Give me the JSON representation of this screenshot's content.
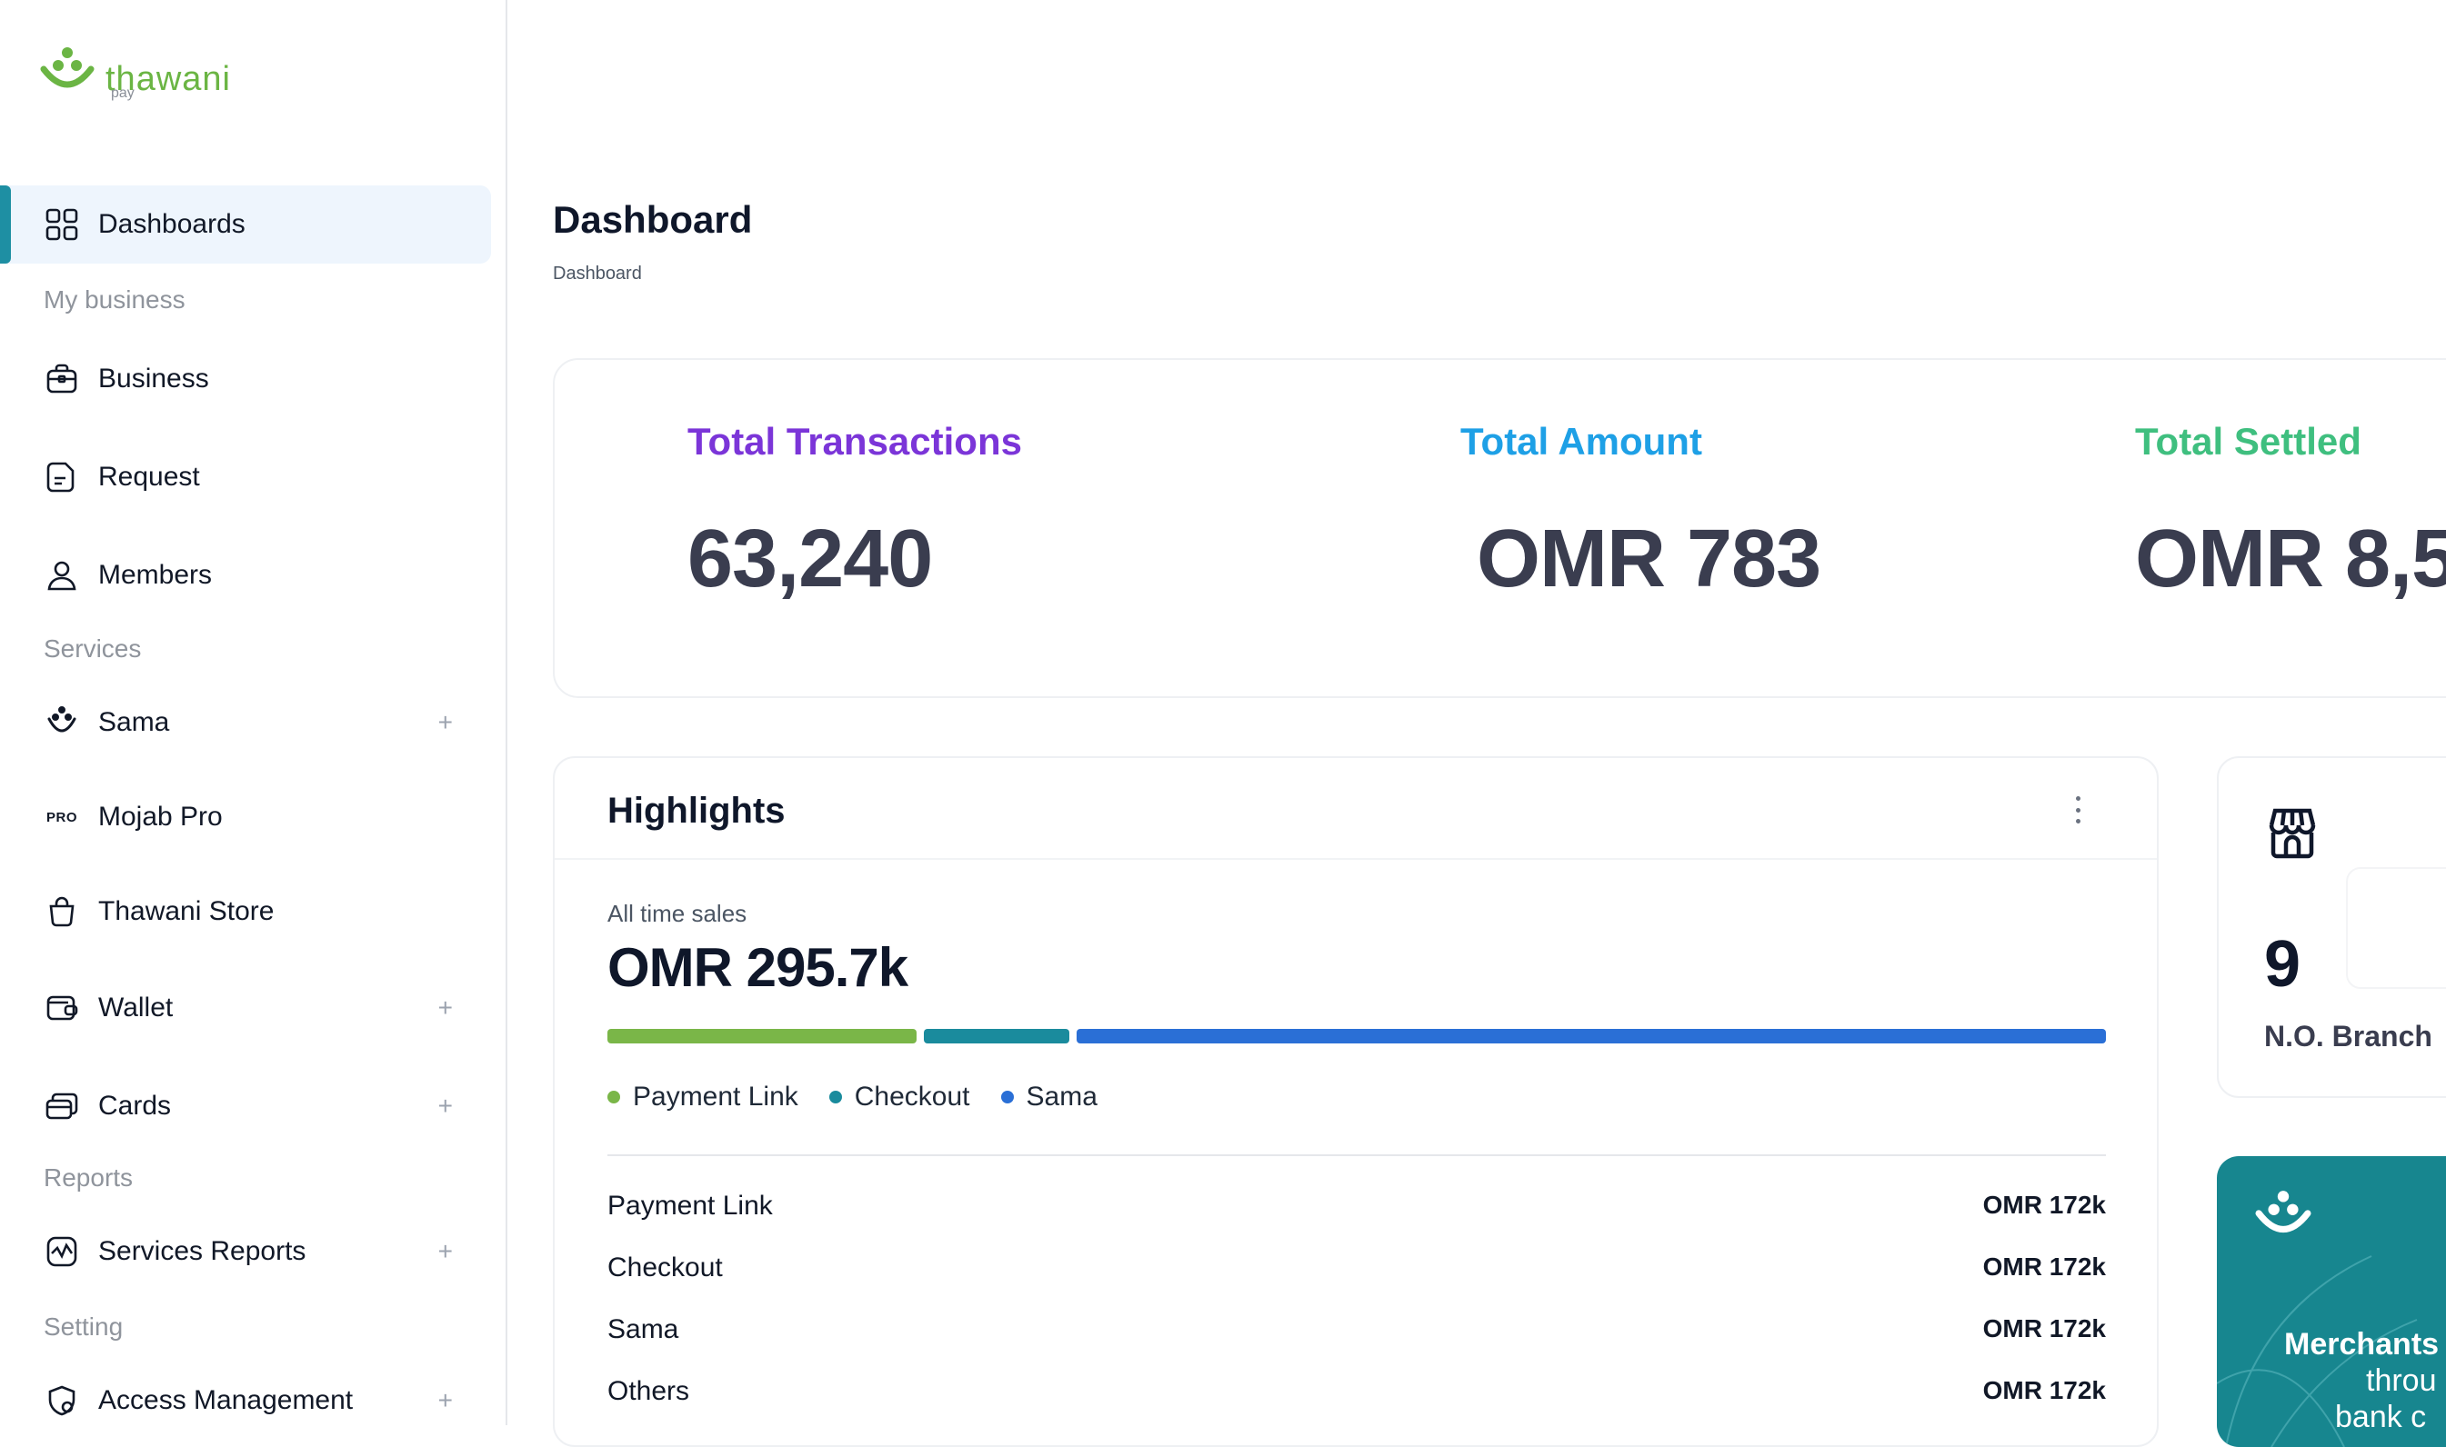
{
  "brand": {
    "name": "thawani",
    "sub": "pay",
    "accent": "#6bb544",
    "primary": "#1e8fa3"
  },
  "sidebar": {
    "active": {
      "label": "Dashboards",
      "icon": "grid-icon"
    },
    "sections": {
      "my_business": "My business",
      "services": "Services",
      "reports": "Reports",
      "setting": "Setting"
    },
    "items": {
      "business": {
        "label": "Business",
        "icon": "briefcase-icon"
      },
      "request": {
        "label": "Request",
        "icon": "document-icon"
      },
      "members": {
        "label": "Members",
        "icon": "user-icon"
      },
      "sama": {
        "label": "Sama",
        "icon": "sama-icon",
        "expand": "+"
      },
      "mojab_pro": {
        "label": "Mojab Pro",
        "icon": "pro-icon",
        "icon_text": "PRO"
      },
      "thawani_store": {
        "label": "Thawani Store",
        "icon": "bag-icon"
      },
      "wallet": {
        "label": "Wallet",
        "icon": "wallet-icon",
        "expand": "+"
      },
      "cards": {
        "label": "Cards",
        "icon": "cards-icon",
        "expand": "+"
      },
      "services_reports": {
        "label": "Services Reports",
        "icon": "chart-icon",
        "expand": "+"
      },
      "access_management": {
        "label": "Access Management",
        "icon": "shield-gear-icon",
        "expand": "+"
      }
    }
  },
  "header": {
    "title": "Dashboard",
    "breadcrumb": "Dashboard"
  },
  "stats": [
    {
      "label": "Total Transactions",
      "value": "63,240",
      "color": "#7b35d8"
    },
    {
      "label": "Total Amount",
      "value": "OMR 783",
      "color": "#1ea0e6"
    },
    {
      "label": "Total Settled",
      "value": "OMR 8,5",
      "color": "#3fbf7f"
    }
  ],
  "highlights": {
    "title": "Highlights",
    "all_time_label": "All time sales",
    "all_time_value": "OMR 295.7k",
    "legend": [
      {
        "name": "Payment Link",
        "color": "#7ab648"
      },
      {
        "name": "Checkout",
        "color": "#1a8b9d"
      },
      {
        "name": "Sama",
        "color": "#2a6fd6"
      }
    ],
    "rows": [
      {
        "label": "Payment Link",
        "value": "OMR 172k"
      },
      {
        "label": "Checkout",
        "value": "OMR 172k"
      },
      {
        "label": "Sama",
        "value": "OMR 172k"
      },
      {
        "label": "Others",
        "value": "OMR 172k"
      }
    ]
  },
  "branch": {
    "count": "9",
    "label": "N.O. Branch",
    "icon": "store-icon"
  },
  "promo": {
    "line1": "Merchants",
    "line2": "throu",
    "line3": "bank c"
  }
}
